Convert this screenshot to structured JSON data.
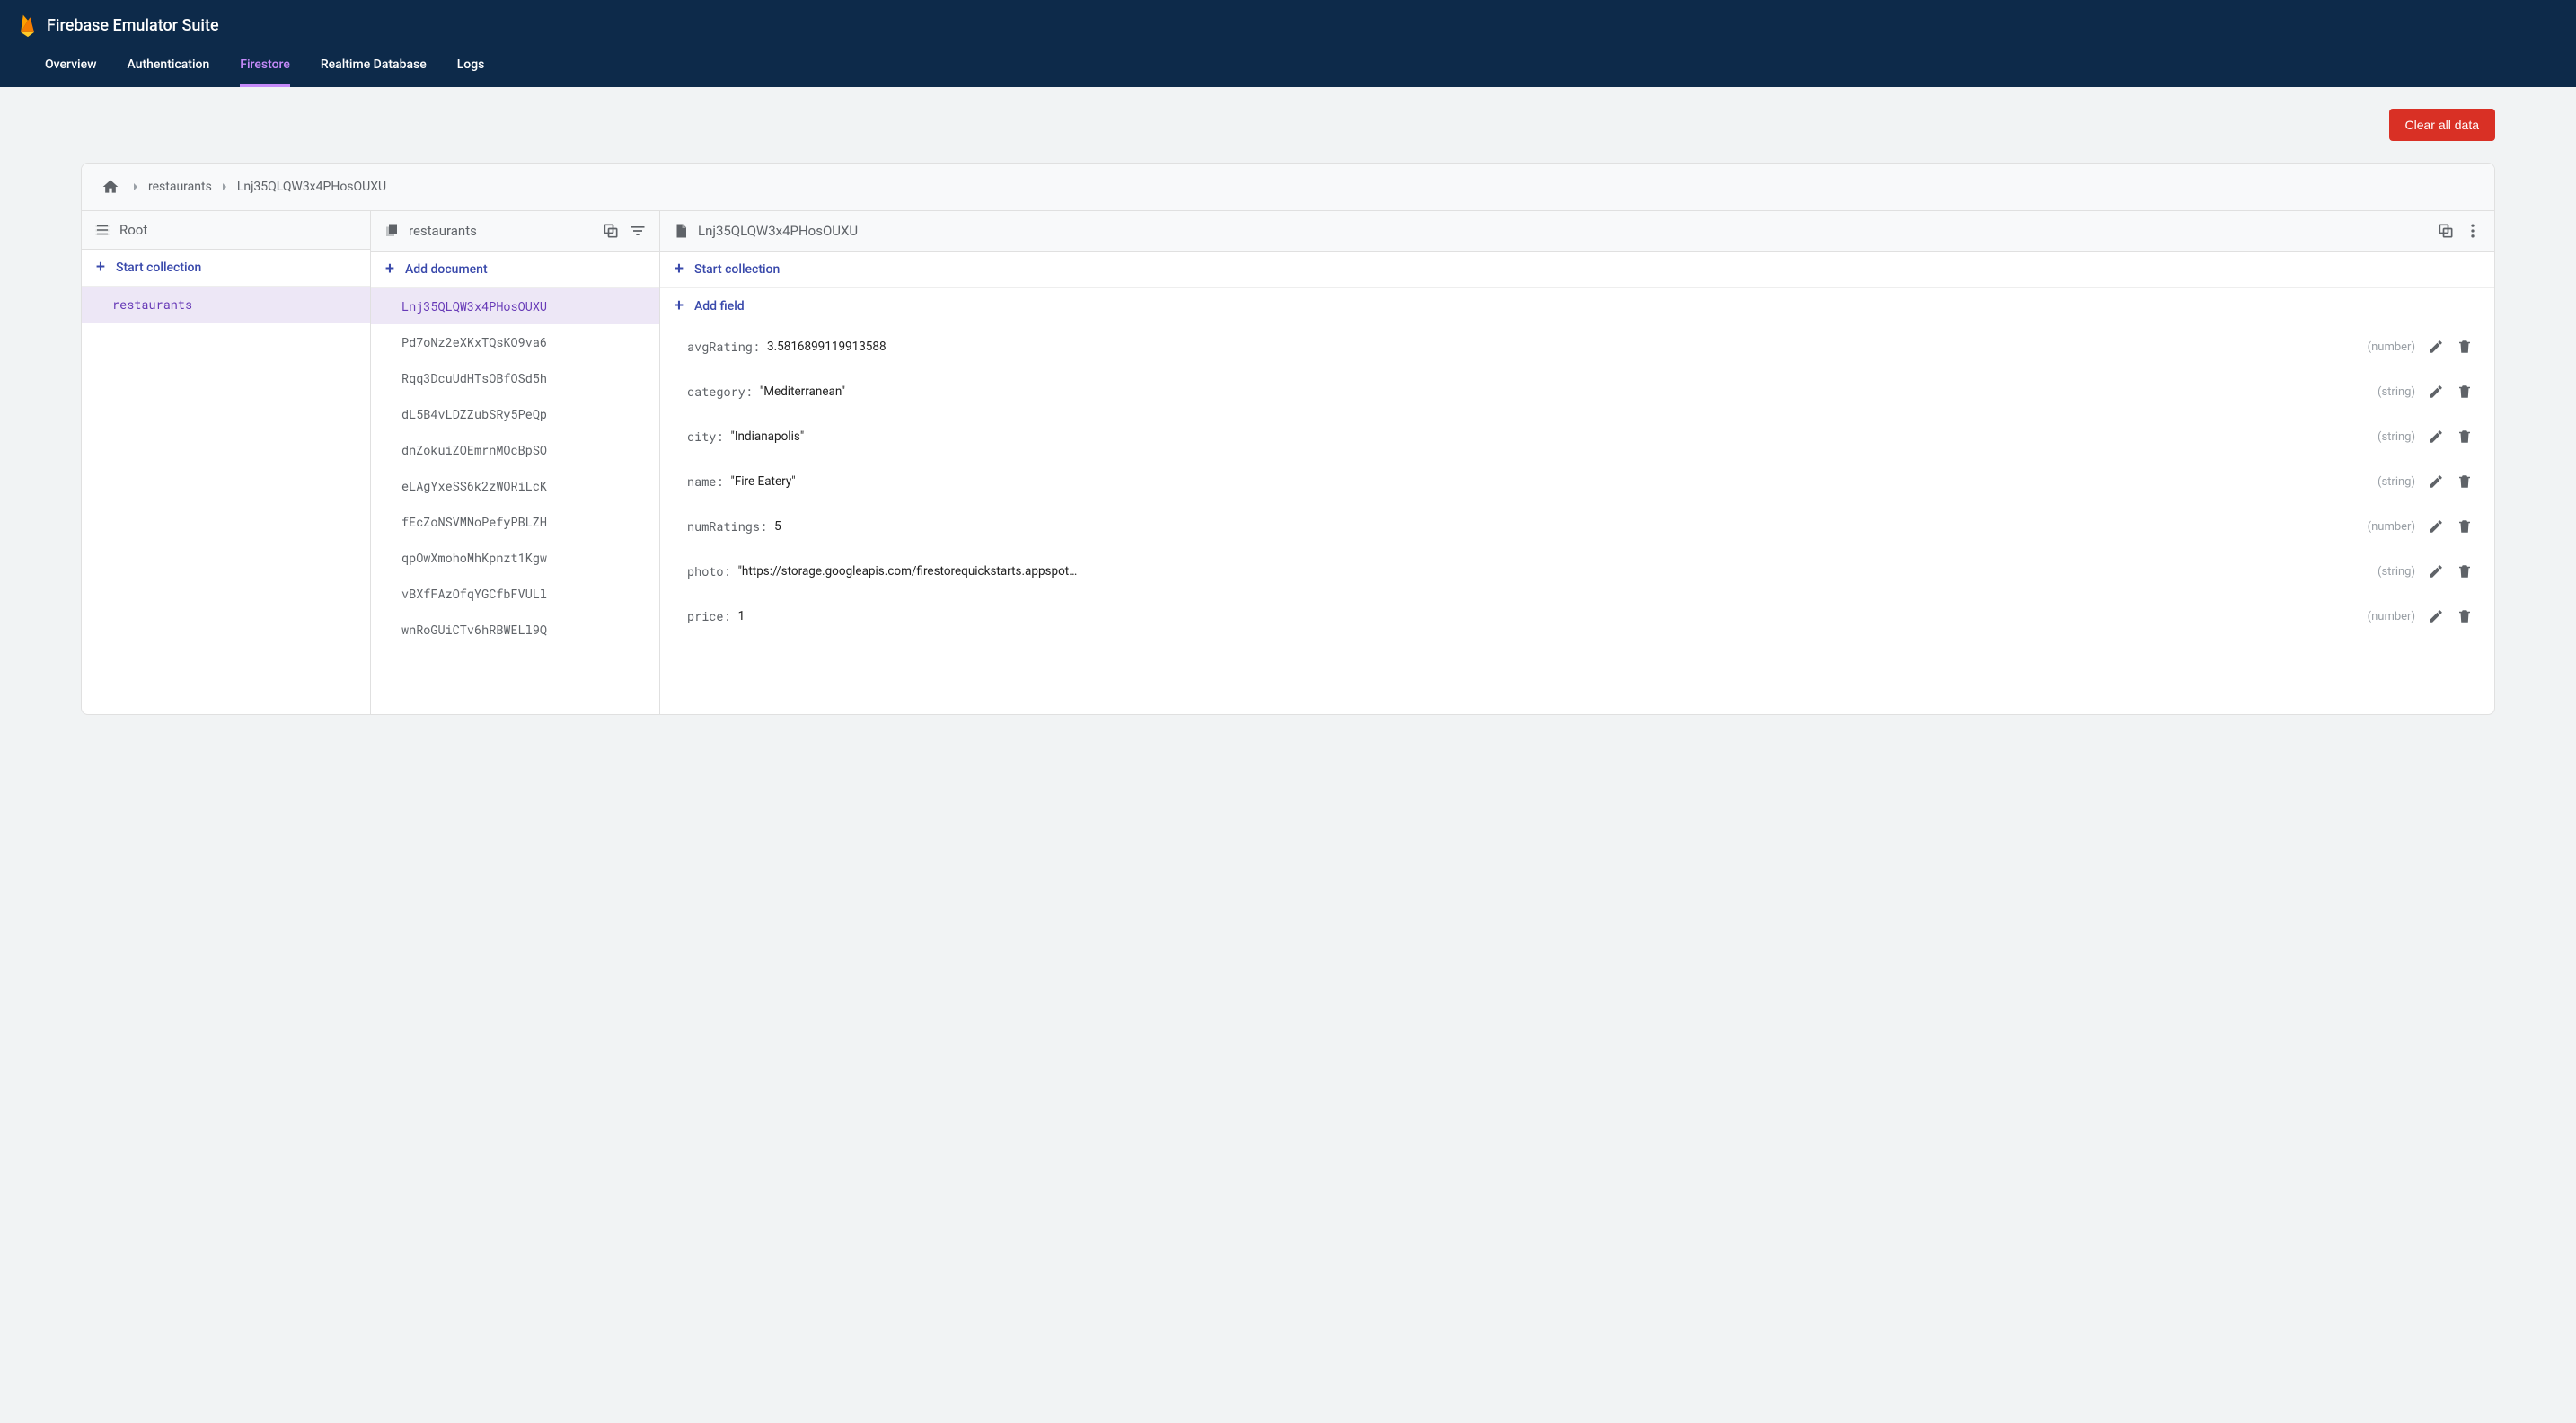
{
  "header": {
    "title": "Firebase Emulator Suite",
    "tabs": [
      "Overview",
      "Authentication",
      "Firestore",
      "Realtime Database",
      "Logs"
    ],
    "active_tab_index": 2
  },
  "toolbar": {
    "clear_label": "Clear all data"
  },
  "breadcrumbs": {
    "items": [
      "restaurants",
      "Lnj35QLQW3x4PHosOUXU"
    ]
  },
  "col_root": {
    "title": "Root",
    "action": "Start collection",
    "items": [
      "restaurants"
    ],
    "selected_index": 0
  },
  "col_docs": {
    "title": "restaurants",
    "action": "Add document",
    "items": [
      "Lnj35QLQW3x4PHosOUXU",
      "Pd7oNz2eXKxTQsKO9va6",
      "Rqq3DcuUdHTsOBfOSd5h",
      "dL5B4vLDZZubSRy5PeQp",
      "dnZokuiZOEmrnMOcBpSO",
      "eLAgYxeSS6k2zWORiLcK",
      "fEcZoNSVMNoPefyPBLZH",
      "qpOwXmohoMhKpnzt1Kgw",
      "vBXfFAzOfqYGCfbFVULl",
      "wnRoGUiCTv6hRBWELl9Q"
    ],
    "selected_index": 0
  },
  "col_fields": {
    "title": "Lnj35QLQW3x4PHosOUXU",
    "action": "Start collection",
    "add_field": "Add field",
    "fields": [
      {
        "key": "avgRating",
        "value": "3.5816899119913588",
        "type": "number",
        "quoted": false
      },
      {
        "key": "category",
        "value": "Mediterranean",
        "type": "string",
        "quoted": true
      },
      {
        "key": "city",
        "value": "Indianapolis",
        "type": "string",
        "quoted": true
      },
      {
        "key": "name",
        "value": "Fire Eatery",
        "type": "string",
        "quoted": true
      },
      {
        "key": "numRatings",
        "value": "5",
        "type": "number",
        "quoted": false
      },
      {
        "key": "photo",
        "value": "https://storage.googleapis.com/firestorequickstarts.appspot.…",
        "type": "string",
        "quoted": true
      },
      {
        "key": "price",
        "value": "1",
        "type": "number",
        "quoted": false
      }
    ]
  }
}
